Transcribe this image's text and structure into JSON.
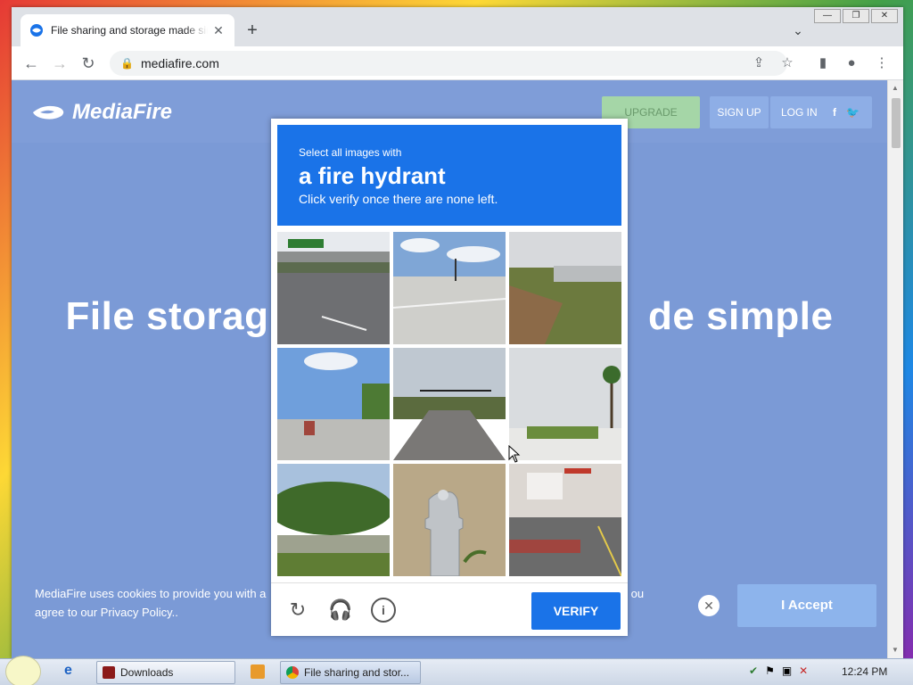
{
  "browser": {
    "tab_title": "File sharing and storage made simple",
    "new_tab": "+",
    "tab_close": "✕",
    "url": "mediafire.com",
    "window_controls": [
      "—",
      "❐",
      "✕"
    ]
  },
  "site": {
    "logo_text": "MediaFire",
    "upgrade_label": "UPGRADE",
    "signup_label": "SIGN UP",
    "login_label": "LOG IN",
    "headline_left": "File storag",
    "headline_right": "de simple"
  },
  "cookie": {
    "text_line1": "MediaFire uses cookies to provide you with a",
    "text_line1_tail": "ou",
    "text_line2": "agree to our Privacy Policy..",
    "accept_label": "I Accept",
    "close": "✕"
  },
  "captcha": {
    "prompt_small": "Select all images with",
    "target": "a fire hydrant",
    "instruction": "Click verify once there are none left.",
    "verify_label": "VERIFY",
    "tiles": [
      "overpass-road",
      "empty-intersection",
      "bridge-grass",
      "road-truck",
      "highway-signals",
      "palm-trees-street",
      "trees-roadside",
      "fire-hydrant",
      "city-crosswalk"
    ]
  },
  "taskbar": {
    "downloads_label": "Downloads",
    "chrome_label": "File sharing and stor...",
    "clock": "12:24 PM"
  },
  "colors": {
    "page_bg": "#7b9ad6",
    "captcha_blue": "#1a73e8",
    "accept_blue": "#8db4ec",
    "upgrade_green": "#a5d6a7"
  }
}
